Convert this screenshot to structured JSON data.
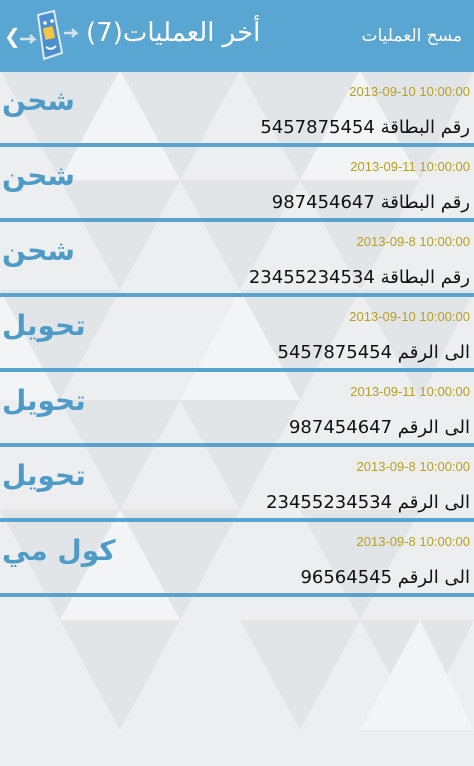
{
  "header": {
    "title": "أخر العمليات(7)",
    "clear_label": "مسح العمليات",
    "back_glyph": "❮",
    "app_icon": "sim-card-transfer-icon",
    "color": "#5aa6d2"
  },
  "transactions": [
    {
      "type": "شحن",
      "date": "2013-09-10 10:00:00",
      "detail": "رقم البطاقة 5457875454"
    },
    {
      "type": "شحن",
      "date": "2013-09-11 10:00:00",
      "detail": "رقم البطاقة 987454647"
    },
    {
      "type": "شحن",
      "date": "2013-09-8 10:00:00",
      "detail": "رقم البطاقة 23455234534"
    },
    {
      "type": "تحويل",
      "date": "2013-09-10 10:00:00",
      "detail": "الى الرقم 5457875454"
    },
    {
      "type": "تحويل",
      "date": "2013-09-11 10:00:00",
      "detail": "الى الرقم 987454647"
    },
    {
      "type": "تحويل",
      "date": "2013-09-8 10:00:00",
      "detail": "الى الرقم 23455234534"
    },
    {
      "type": "كول مي",
      "date": "2013-09-8 10:00:00",
      "detail": "الى الرقم 96564545"
    }
  ],
  "colors": {
    "accent": "#59a3cf",
    "date": "#b8a022",
    "type_text": "#4f9bc8"
  }
}
